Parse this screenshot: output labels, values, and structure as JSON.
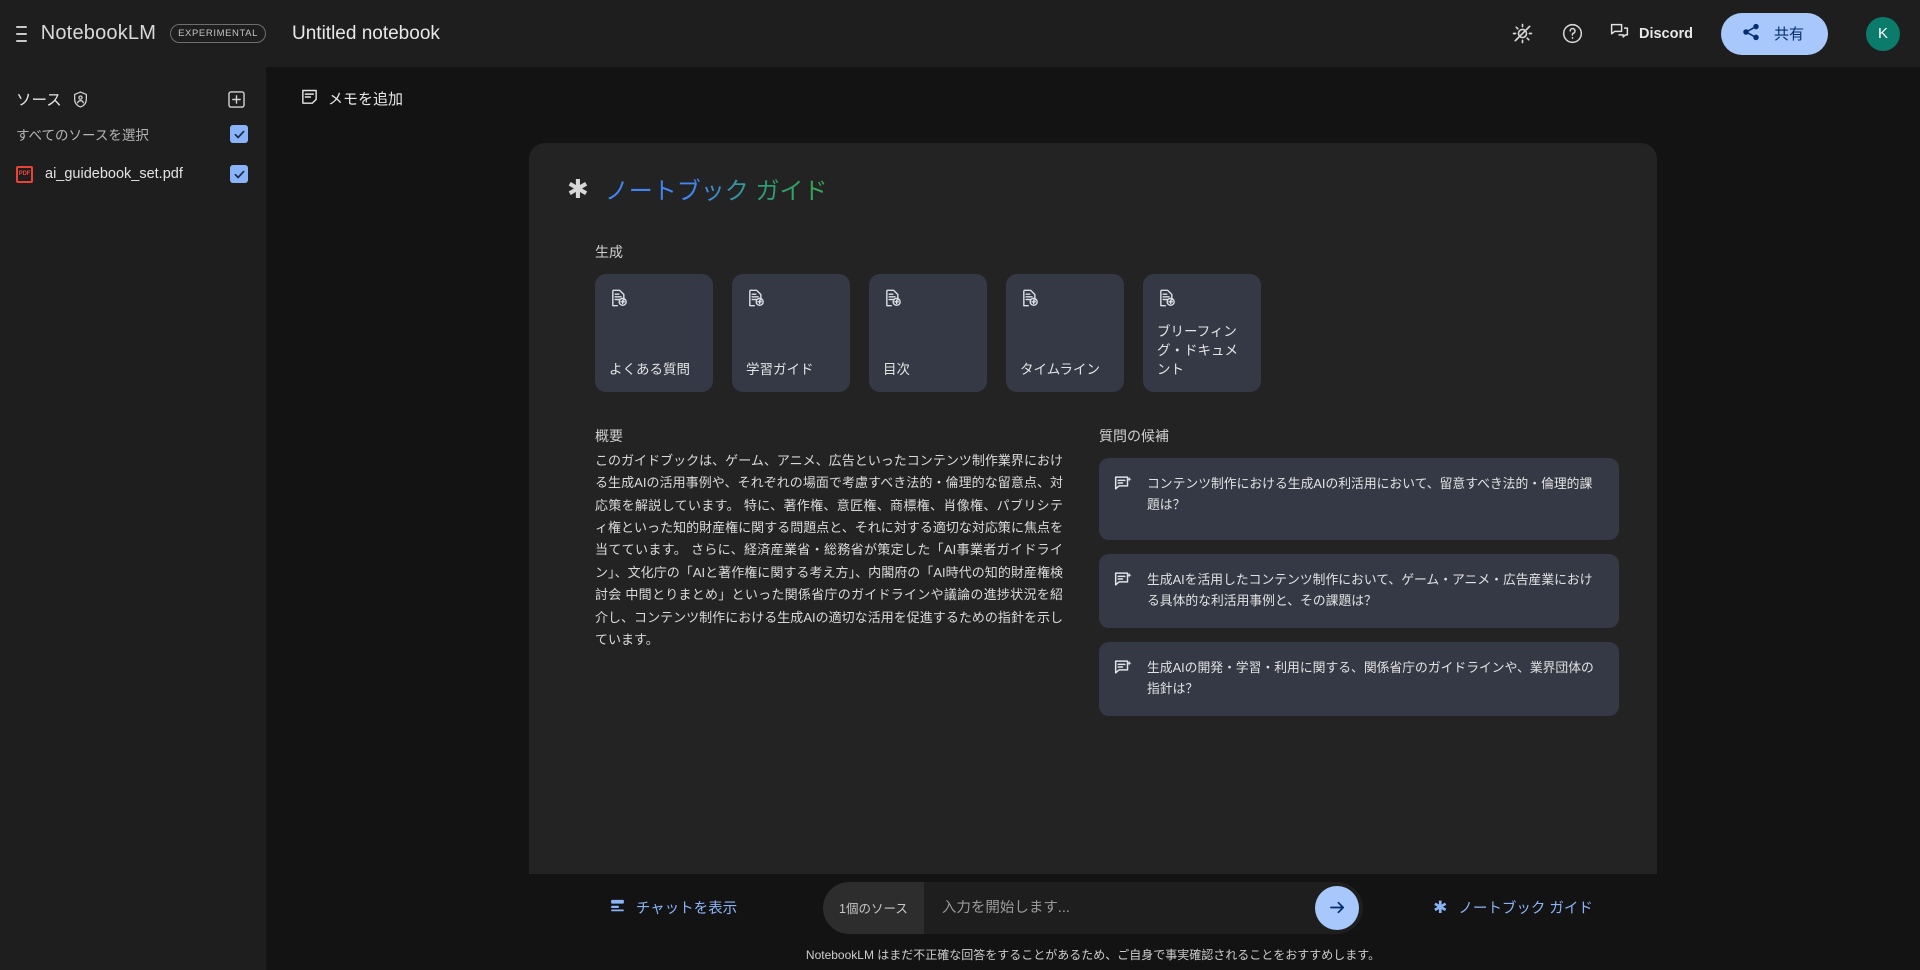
{
  "app": {
    "brand": "NotebookLM",
    "experimental_badge": "EXPERIMENTAL",
    "notebook_title": "Untitled notebook"
  },
  "topbar": {
    "theme_icon": "brightness-icon",
    "help_icon": "help-circle-icon",
    "discord_icon": "chat-bubble-icon",
    "discord_label": "Discord",
    "share_icon": "share-icon",
    "share_label": "共有",
    "avatar_initial": "K",
    "avatar_color": "#0b7b6b",
    "share_bg": "#a8c7fa",
    "share_fg": "#062e6f"
  },
  "sidebar": {
    "sources_label": "ソース",
    "sources_icon": "shield-person-icon",
    "add_icon": "plus-box-icon",
    "select_all_label": "すべてのソースを選択",
    "select_all_checked": true,
    "files": [
      {
        "name": "ai_guidebook_set.pdf",
        "type_badge": "PDF",
        "type_color": "#ea4335",
        "checked": true
      }
    ]
  },
  "main": {
    "add_note_icon": "note-add-icon",
    "add_note_label": "メモを追加"
  },
  "guide": {
    "star_icon": "sparkle-icon",
    "title": "ノートブック ガイド",
    "title_gradient_from": "#4285f4",
    "title_gradient_to": "#34a853",
    "generate_label": "生成",
    "generate_cards": [
      {
        "icon": "document-add-icon",
        "label": "よくある質問"
      },
      {
        "icon": "document-add-icon",
        "label": "学習ガイド"
      },
      {
        "icon": "document-add-icon",
        "label": "目次"
      },
      {
        "icon": "document-add-icon",
        "label": "タイムライン"
      },
      {
        "icon": "document-add-icon",
        "label": "ブリーフィング・ドキュメント"
      }
    ],
    "summary_label": "概要",
    "summary_text": "このガイドブックは、ゲーム、アニメ、広告といったコンテンツ制作業界における生成AIの活用事例や、それぞれの場面で考慮すべき法的・倫理的な留意点、対応策を解説しています。 特に、著作権、意匠権、商標権、肖像権、パブリシティ権といった知的財産権に関する問題点と、それに対する適切な対応策に焦点を当てています。 さらに、経済産業省・総務省が策定した「AI事業者ガイドライン」、文化庁の「AIと著作権に関する考え方」、内閣府の「AI時代の知的財産権検討会 中間とりまとめ」といった関係省庁のガイドラインや議論の進捗状況を紹介し、コンテンツ制作における生成AIの適切な活用を促進するための指針を示しています。",
    "questions_label": "質問の候補",
    "questions": [
      {
        "icon": "question-note-icon",
        "text": "コンテンツ制作における生成AIの利活用において、留意すべき法的・倫理的課題は？"
      },
      {
        "icon": "question-note-icon",
        "text": "生成AIを活用したコンテンツ制作において、ゲーム・アニメ・広告産業における具体的な利活用事例と、その課題は？"
      },
      {
        "icon": "question-note-icon",
        "text": "生成AIの開発・学習・利用に関する、関係省庁のガイドラインや、業界団体の指針は？"
      }
    ]
  },
  "bottom": {
    "chat_icon": "chat-panel-icon",
    "chat_label": "チャットを表示",
    "source_chip": "1個のソース",
    "input_value": "",
    "input_placeholder": "入力を開始します...",
    "send_icon": "arrow-right-icon",
    "guide_icon": "sparkle-icon",
    "guide_label": "ノートブック ガイド",
    "disclaimer": "NotebookLM はまだ不正確な回答をすることがあるため、ご自身で事実確認されることをおすすめします。"
  }
}
